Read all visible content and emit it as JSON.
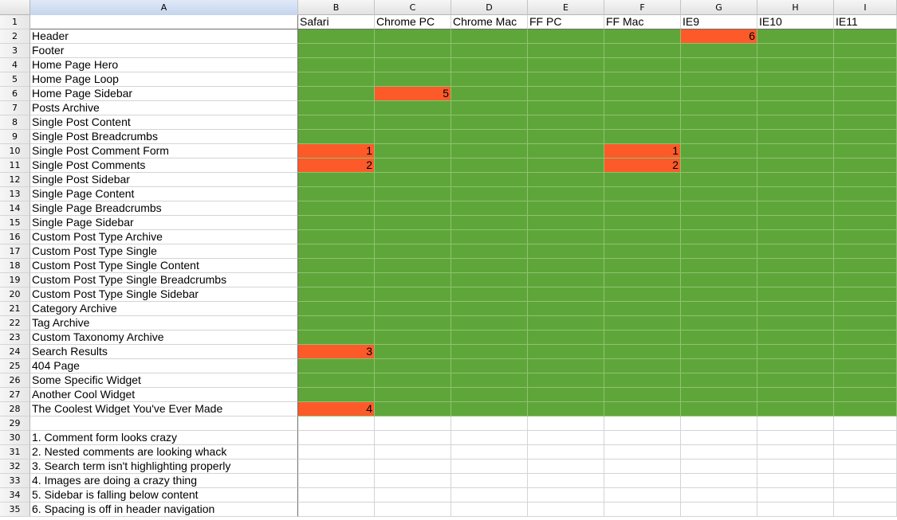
{
  "columns": [
    "A",
    "B",
    "C",
    "D",
    "E",
    "F",
    "G",
    "H",
    "I"
  ],
  "selected_column": "A",
  "header_row": {
    "num": "1",
    "values": [
      "",
      "Safari",
      "Chrome PC",
      "Chrome Mac",
      "FF PC",
      "FF Mac",
      "IE9",
      "IE10",
      "IE11"
    ]
  },
  "rows": [
    {
      "num": "2",
      "label": "Header",
      "cells": [
        "",
        "",
        "",
        "",
        "",
        "6",
        "",
        ""
      ]
    },
    {
      "num": "3",
      "label": "Footer",
      "cells": [
        "",
        "",
        "",
        "",
        "",
        "",
        "",
        ""
      ]
    },
    {
      "num": "4",
      "label": "Home Page Hero",
      "cells": [
        "",
        "",
        "",
        "",
        "",
        "",
        "",
        ""
      ]
    },
    {
      "num": "5",
      "label": "Home Page Loop",
      "cells": [
        "",
        "",
        "",
        "",
        "",
        "",
        "",
        ""
      ]
    },
    {
      "num": "6",
      "label": "Home Page Sidebar",
      "cells": [
        "",
        "5",
        "",
        "",
        "",
        "",
        "",
        ""
      ]
    },
    {
      "num": "7",
      "label": "Posts Archive",
      "cells": [
        "",
        "",
        "",
        "",
        "",
        "",
        "",
        ""
      ]
    },
    {
      "num": "8",
      "label": "Single Post Content",
      "cells": [
        "",
        "",
        "",
        "",
        "",
        "",
        "",
        ""
      ]
    },
    {
      "num": "9",
      "label": "Single Post Breadcrumbs",
      "cells": [
        "",
        "",
        "",
        "",
        "",
        "",
        "",
        ""
      ]
    },
    {
      "num": "10",
      "label": "Single Post Comment Form",
      "cells": [
        "1",
        "",
        "",
        "",
        "1",
        "",
        "",
        ""
      ]
    },
    {
      "num": "11",
      "label": "Single Post Comments",
      "cells": [
        "2",
        "",
        "",
        "",
        "2",
        "",
        "",
        ""
      ]
    },
    {
      "num": "12",
      "label": "Single Post Sidebar",
      "cells": [
        "",
        "",
        "",
        "",
        "",
        "",
        "",
        ""
      ]
    },
    {
      "num": "13",
      "label": "Single Page Content",
      "cells": [
        "",
        "",
        "",
        "",
        "",
        "",
        "",
        ""
      ]
    },
    {
      "num": "14",
      "label": "Single Page Breadcrumbs",
      "cells": [
        "",
        "",
        "",
        "",
        "",
        "",
        "",
        ""
      ]
    },
    {
      "num": "15",
      "label": "Single Page Sidebar",
      "cells": [
        "",
        "",
        "",
        "",
        "",
        "",
        "",
        ""
      ]
    },
    {
      "num": "16",
      "label": "Custom Post Type Archive",
      "cells": [
        "",
        "",
        "",
        "",
        "",
        "",
        "",
        ""
      ]
    },
    {
      "num": "17",
      "label": "Custom Post Type Single",
      "cells": [
        "",
        "",
        "",
        "",
        "",
        "",
        "",
        ""
      ]
    },
    {
      "num": "18",
      "label": "Custom Post Type Single Content",
      "cells": [
        "",
        "",
        "",
        "",
        "",
        "",
        "",
        ""
      ]
    },
    {
      "num": "19",
      "label": "Custom Post Type Single Breadcrumbs",
      "cells": [
        "",
        "",
        "",
        "",
        "",
        "",
        "",
        ""
      ]
    },
    {
      "num": "20",
      "label": "Custom Post Type Single Sidebar",
      "cells": [
        "",
        "",
        "",
        "",
        "",
        "",
        "",
        ""
      ]
    },
    {
      "num": "21",
      "label": "Category Archive",
      "cells": [
        "",
        "",
        "",
        "",
        "",
        "",
        "",
        ""
      ]
    },
    {
      "num": "22",
      "label": "Tag Archive",
      "cells": [
        "",
        "",
        "",
        "",
        "",
        "",
        "",
        ""
      ]
    },
    {
      "num": "23",
      "label": "Custom Taxonomy Archive",
      "cells": [
        "",
        "",
        "",
        "",
        "",
        "",
        "",
        ""
      ]
    },
    {
      "num": "24",
      "label": "Search Results",
      "cells": [
        "3",
        "",
        "",
        "",
        "",
        "",
        "",
        ""
      ]
    },
    {
      "num": "25",
      "label": "404 Page",
      "cells": [
        "",
        "",
        "",
        "",
        "",
        "",
        "",
        ""
      ]
    },
    {
      "num": "26",
      "label": "Some Specific Widget",
      "cells": [
        "",
        "",
        "",
        "",
        "",
        "",
        "",
        ""
      ]
    },
    {
      "num": "27",
      "label": "Another Cool Widget",
      "cells": [
        "",
        "",
        "",
        "",
        "",
        "",
        "",
        ""
      ]
    },
    {
      "num": "28",
      "label": "The Coolest Widget You've Ever Made",
      "cells": [
        "4",
        "",
        "",
        "",
        "",
        "",
        "",
        ""
      ]
    }
  ],
  "blank_row": {
    "num": "29"
  },
  "notes": [
    {
      "num": "30",
      "text": "1. Comment form looks crazy"
    },
    {
      "num": "31",
      "text": "2. Nested comments are looking whack"
    },
    {
      "num": "32",
      "text": "3. Search term isn't highlighting properly"
    },
    {
      "num": "33",
      "text": "4. Images are doing a crazy thing"
    },
    {
      "num": "34",
      "text": "5. Sidebar is falling below content"
    },
    {
      "num": "35",
      "text": "6. Spacing is off in header navigation"
    }
  ],
  "colors": {
    "pass": "#5fa63a",
    "fail": "#fd5a2a"
  }
}
